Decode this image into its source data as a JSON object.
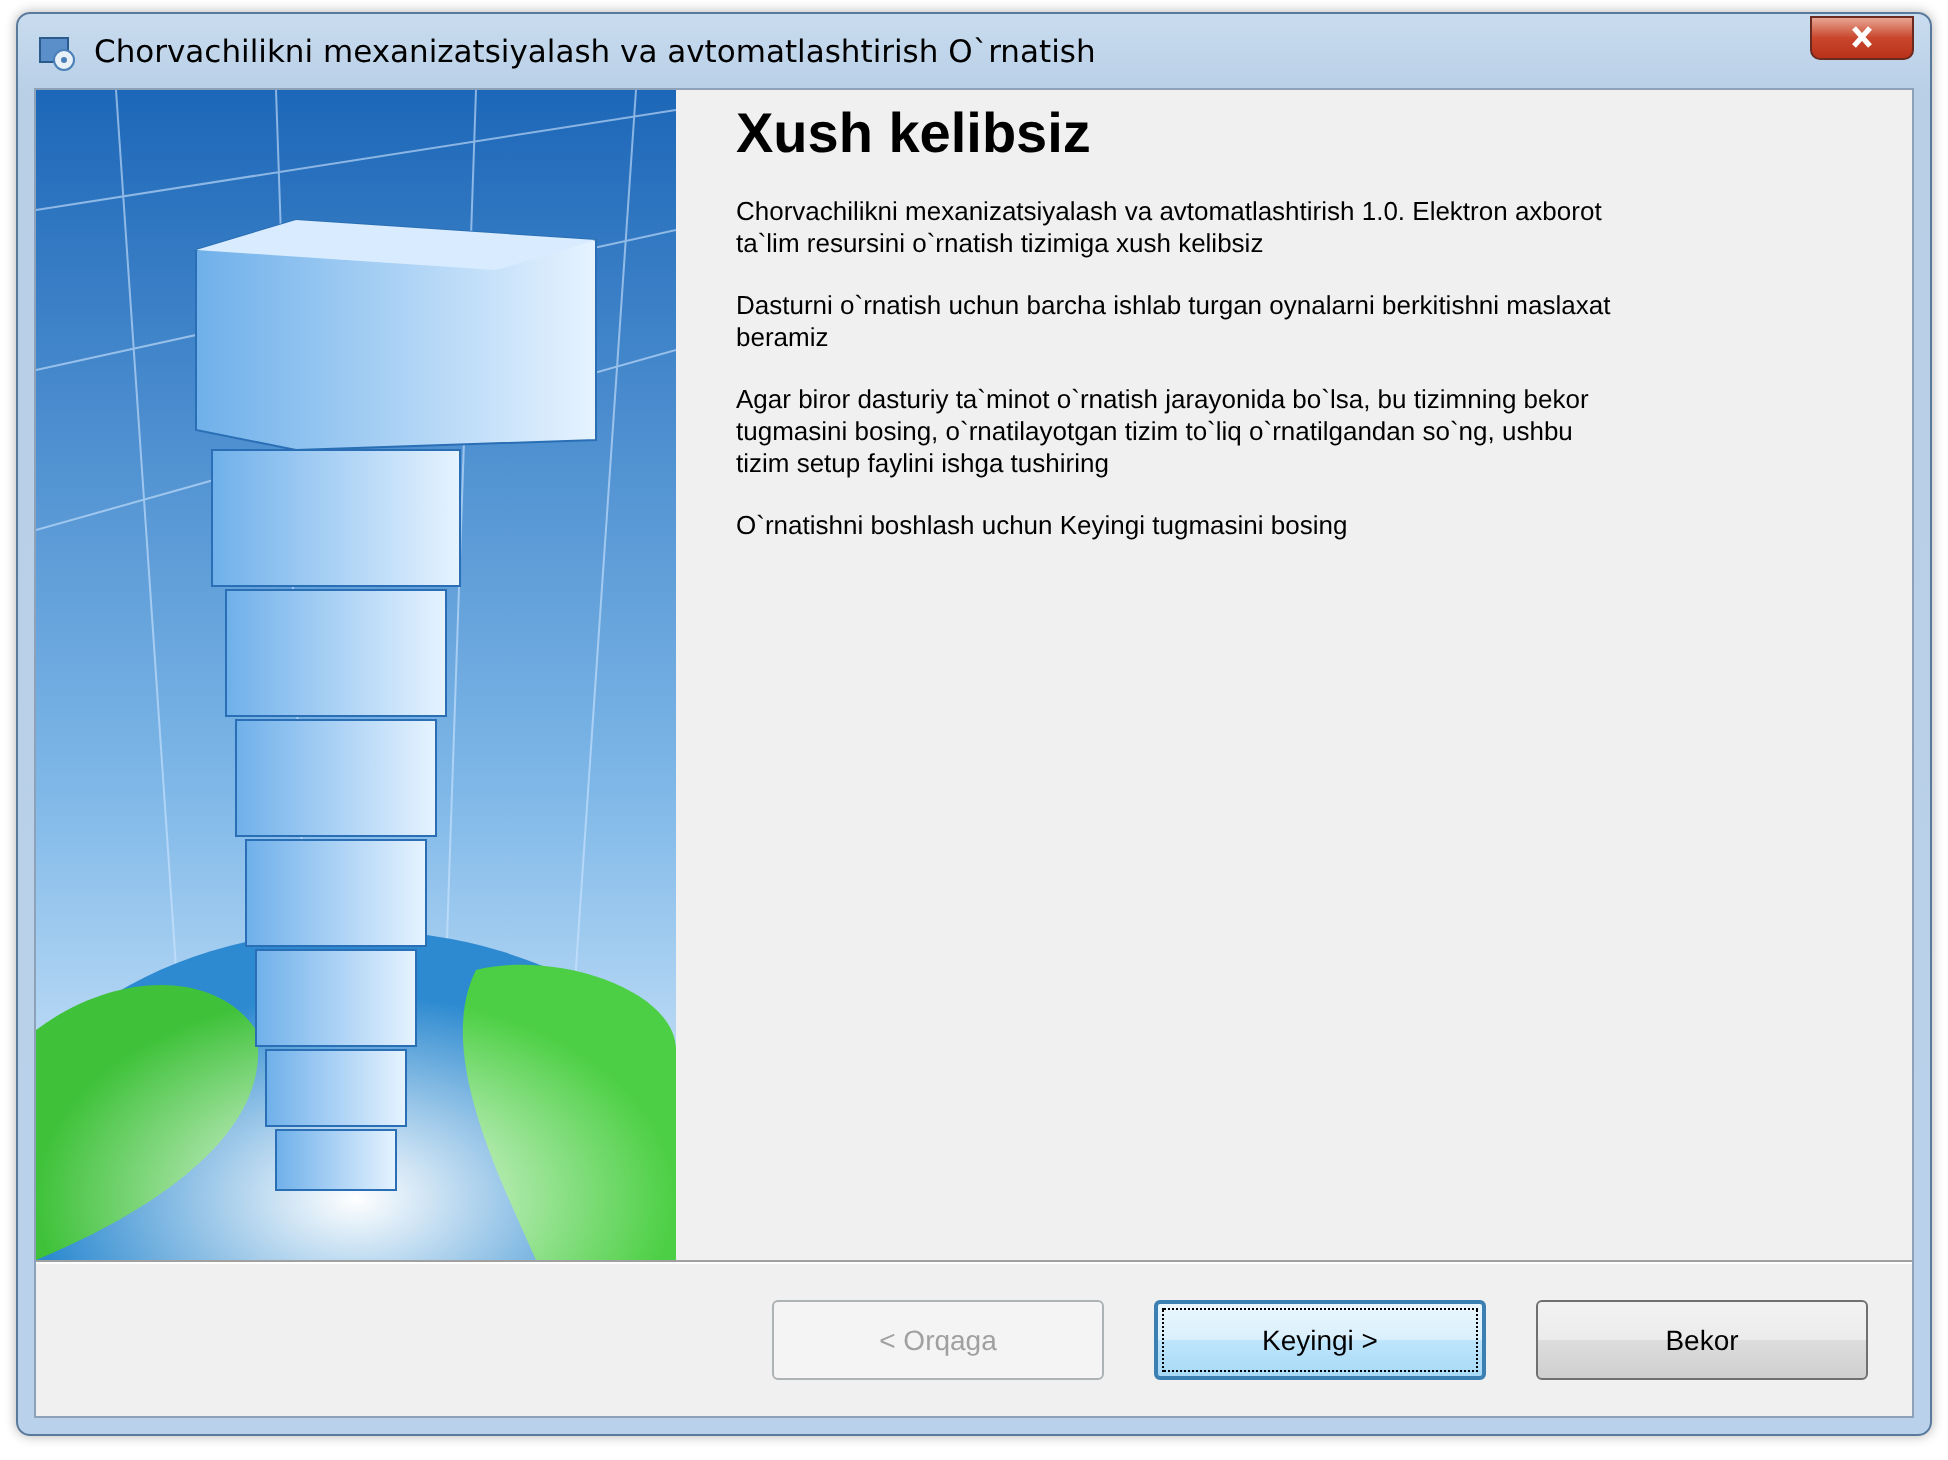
{
  "window": {
    "title": "Chorvachilikni mexanizatsiyalash va avtomatlashtirish O`rnatish"
  },
  "welcome": {
    "heading": "Xush kelibsiz",
    "paragraphs": [
      "Chorvachilikni mexanizatsiyalash va avtomatlashtirish 1.0. Elektron axborot ta`lim resursini o`rnatish tizimiga xush kelibsiz",
      "Dasturni o`rnatish uchun barcha ishlab turgan oynalarni berkitishni maslaxat beramiz",
      "Agar biror dasturiy ta`minot o`rnatish jarayonida bo`lsa, bu tizimning bekor tugmasini bosing, o`rnatilayotgan tizim to`liq o`rnatilgandan so`ng, ushbu tizim setup faylini ishga tushiring",
      "O`rnatishni boshlash uchun Keyingi tugmasini bosing"
    ]
  },
  "buttons": [
    {
      "label": "< Orqaga",
      "disabled": true,
      "default": false
    },
    {
      "label": "Keyingi >",
      "disabled": false,
      "default": true
    },
    {
      "label": "Bekor",
      "disabled": false,
      "default": false
    }
  ]
}
